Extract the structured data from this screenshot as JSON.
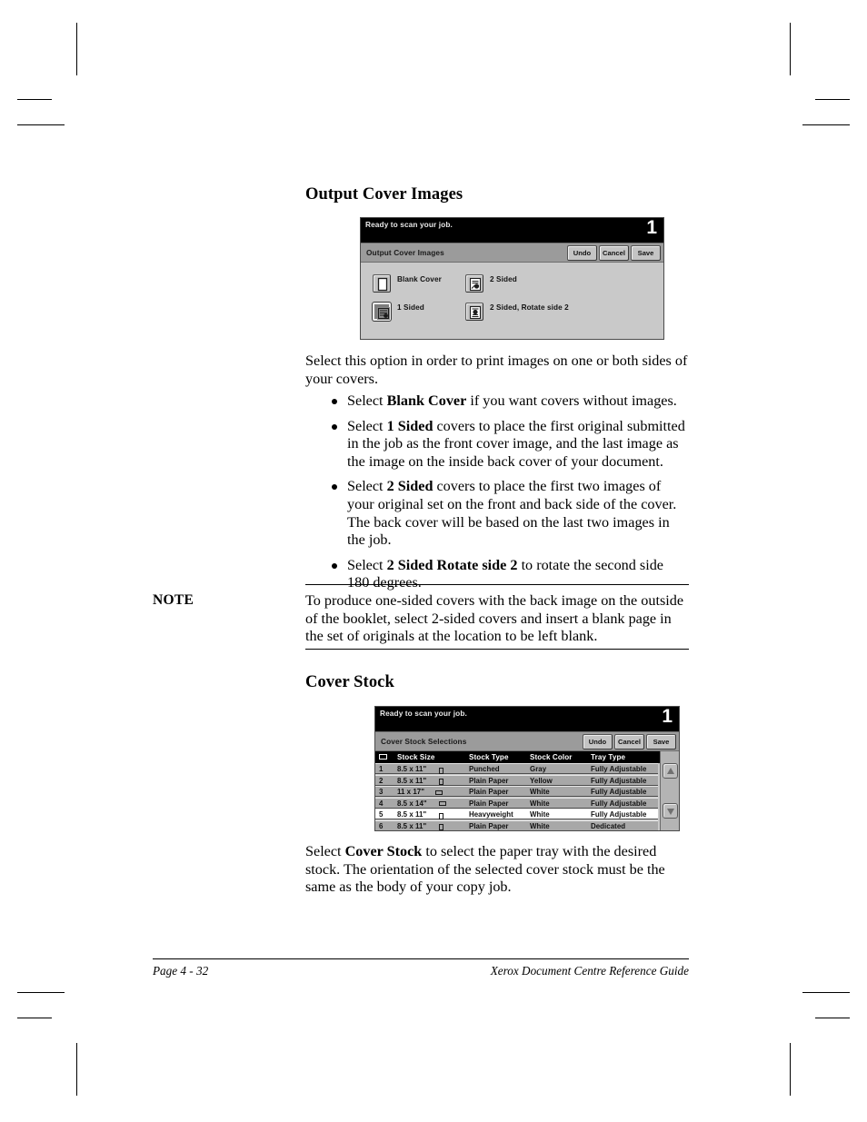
{
  "document": {
    "footer": {
      "page_label": "Page 4 - 32",
      "guide_title": "Xerox Document Centre Reference Guide"
    }
  },
  "sections": [
    {
      "heading": "Output Cover Images",
      "intro": "Select this option in order to print images on one or both sides of your covers.",
      "bullets": [
        {
          "prefix": "Select ",
          "bold": "Blank Cover",
          "suffix": " if you want covers without images."
        },
        {
          "prefix": "Select ",
          "bold": "1 Sided",
          "suffix": " covers to place the first original submitted in the job as the front cover image, and the last image as the image on the inside back cover of your document."
        },
        {
          "prefix": "Select ",
          "bold": "2 Sided",
          "suffix": " covers to place the first two images of your original set on the front and back side of the cover. The back cover will be based on the last two images in the job."
        },
        {
          "prefix": "Select ",
          "bold": "2 Sided Rotate side 2",
          "suffix": " to rotate the second side 180 degrees."
        }
      ]
    },
    {
      "heading": "Cover Stock",
      "body_prefix": "Select ",
      "body_bold": "Cover Stock",
      "body_suffix": " to select the paper tray with the desired stock. The orientation of the selected cover stock must be the same as the body of your copy job."
    }
  ],
  "note": {
    "label": "NOTE",
    "text": "To produce one-sided covers with the back image on the outside of the booklet, select 2-sided covers and insert a blank page in the set of originals at the location to be left blank."
  },
  "screen_output_cover_images": {
    "status_text": "Ready to scan your job.",
    "job_number": "1",
    "title": "Output Cover Images",
    "buttons": {
      "undo": "Undo",
      "cancel": "Cancel",
      "save": "Save"
    },
    "options": [
      {
        "label": "Blank Cover",
        "icon": "blank-page-icon",
        "selected": false
      },
      {
        "label": "1 Sided",
        "icon": "one-sided-page-icon",
        "selected": true
      },
      {
        "label": "2 Sided",
        "icon": "two-sided-page-icon",
        "selected": false
      },
      {
        "label": "2 Sided, Rotate side 2",
        "icon": "two-sided-rotate-page-icon",
        "selected": false
      }
    ]
  },
  "screen_cover_stock": {
    "status_text": "Ready to scan your job.",
    "job_number": "1",
    "title": "Cover Stock Selections",
    "buttons": {
      "undo": "Undo",
      "cancel": "Cancel",
      "save": "Save"
    },
    "columns": [
      "",
      "Stock Size",
      "Stock Type",
      "Stock Color",
      "Tray Type"
    ],
    "rows": [
      {
        "no": "1",
        "size": "8.5 x 11\"",
        "orientation": "portrait",
        "type": "Punched",
        "color": "Gray",
        "tray": "Fully Adjustable",
        "selected": false
      },
      {
        "no": "2",
        "size": "8.5 x 11\"",
        "orientation": "portrait",
        "type": "Plain Paper",
        "color": "Yellow",
        "tray": "Fully Adjustable",
        "selected": false
      },
      {
        "no": "3",
        "size": "11 x 17\"",
        "orientation": "landscape",
        "type": "Plain Paper",
        "color": "White",
        "tray": "Fully Adjustable",
        "selected": false
      },
      {
        "no": "4",
        "size": "8.5 x 14\"",
        "orientation": "landscape",
        "type": "Plain Paper",
        "color": "White",
        "tray": "Fully Adjustable",
        "selected": false
      },
      {
        "no": "5",
        "size": "8.5 x 11\"",
        "orientation": "portrait",
        "type": "Heavyweight",
        "color": "White",
        "tray": "Fully Adjustable",
        "selected": true
      },
      {
        "no": "6",
        "size": "8.5 x 11\"",
        "orientation": "portrait",
        "type": "Plain Paper",
        "color": "White",
        "tray": "Dedicated",
        "selected": false
      }
    ],
    "scroll_up": "scroll-up-arrow",
    "scroll_down": "scroll-down-arrow"
  },
  "colors": {
    "panel_bg": "#c9c9c9",
    "titlebar": "#9b9b9b",
    "status_bar": "#000000",
    "row_bg": "#a8a8a8",
    "row_selected_bg": "#ffffff"
  }
}
